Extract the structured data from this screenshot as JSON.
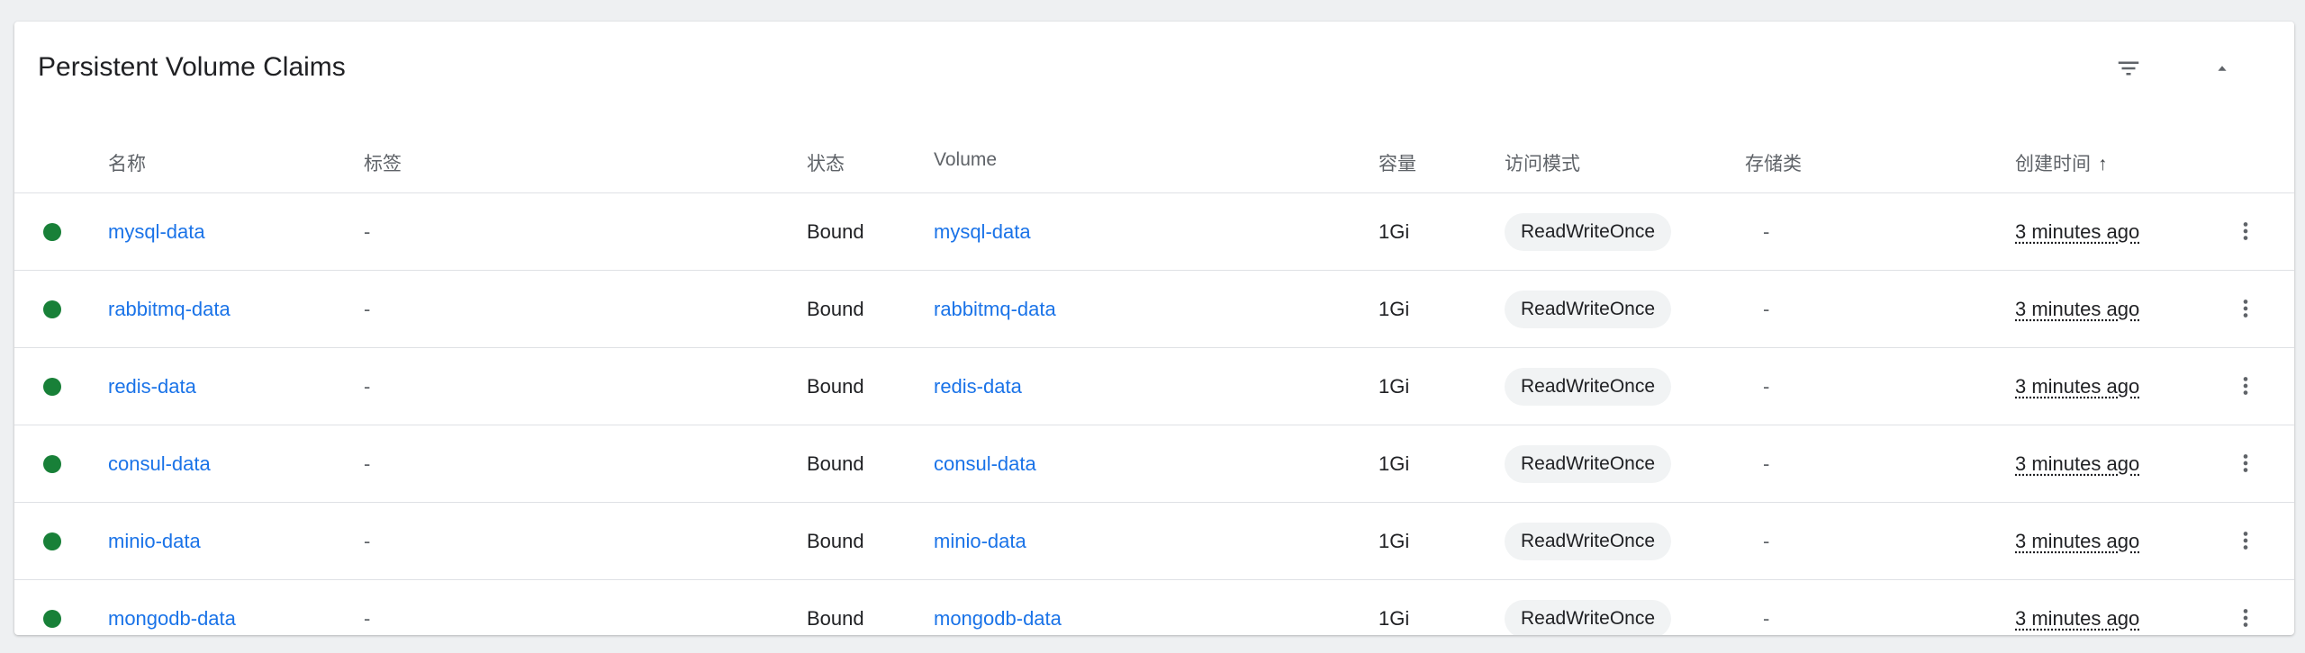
{
  "card": {
    "title": "Persistent Volume Claims",
    "filter_icon": "filter-list-icon",
    "collapse_icon": "arrow-drop-up-icon"
  },
  "columns": {
    "name": "名称",
    "labels": "标签",
    "status": "状态",
    "volume": "Volume",
    "capacity": "容量",
    "access_modes": "访问模式",
    "storage_class": "存储类",
    "created": "创建时间",
    "created_sort_icon": "arrow-upward-icon"
  },
  "colors": {
    "status_ok": "#188038",
    "link": "#1a73e8",
    "chip_bg": "#f1f3f4"
  },
  "rows": [
    {
      "name": "mysql-data",
      "labels": "-",
      "status": "Bound",
      "volume": "mysql-data",
      "capacity": "1Gi",
      "access_mode": "ReadWriteOnce",
      "storage_class": "-",
      "created": "3 minutes ago"
    },
    {
      "name": "rabbitmq-data",
      "labels": "-",
      "status": "Bound",
      "volume": "rabbitmq-data",
      "capacity": "1Gi",
      "access_mode": "ReadWriteOnce",
      "storage_class": "-",
      "created": "3 minutes ago"
    },
    {
      "name": "redis-data",
      "labels": "-",
      "status": "Bound",
      "volume": "redis-data",
      "capacity": "1Gi",
      "access_mode": "ReadWriteOnce",
      "storage_class": "-",
      "created": "3 minutes ago"
    },
    {
      "name": "consul-data",
      "labels": "-",
      "status": "Bound",
      "volume": "consul-data",
      "capacity": "1Gi",
      "access_mode": "ReadWriteOnce",
      "storage_class": "-",
      "created": "3 minutes ago"
    },
    {
      "name": "minio-data",
      "labels": "-",
      "status": "Bound",
      "volume": "minio-data",
      "capacity": "1Gi",
      "access_mode": "ReadWriteOnce",
      "storage_class": "-",
      "created": "3 minutes ago"
    },
    {
      "name": "mongodb-data",
      "labels": "-",
      "status": "Bound",
      "volume": "mongodb-data",
      "capacity": "1Gi",
      "access_mode": "ReadWriteOnce",
      "storage_class": "-",
      "created": "3 minutes ago"
    }
  ]
}
